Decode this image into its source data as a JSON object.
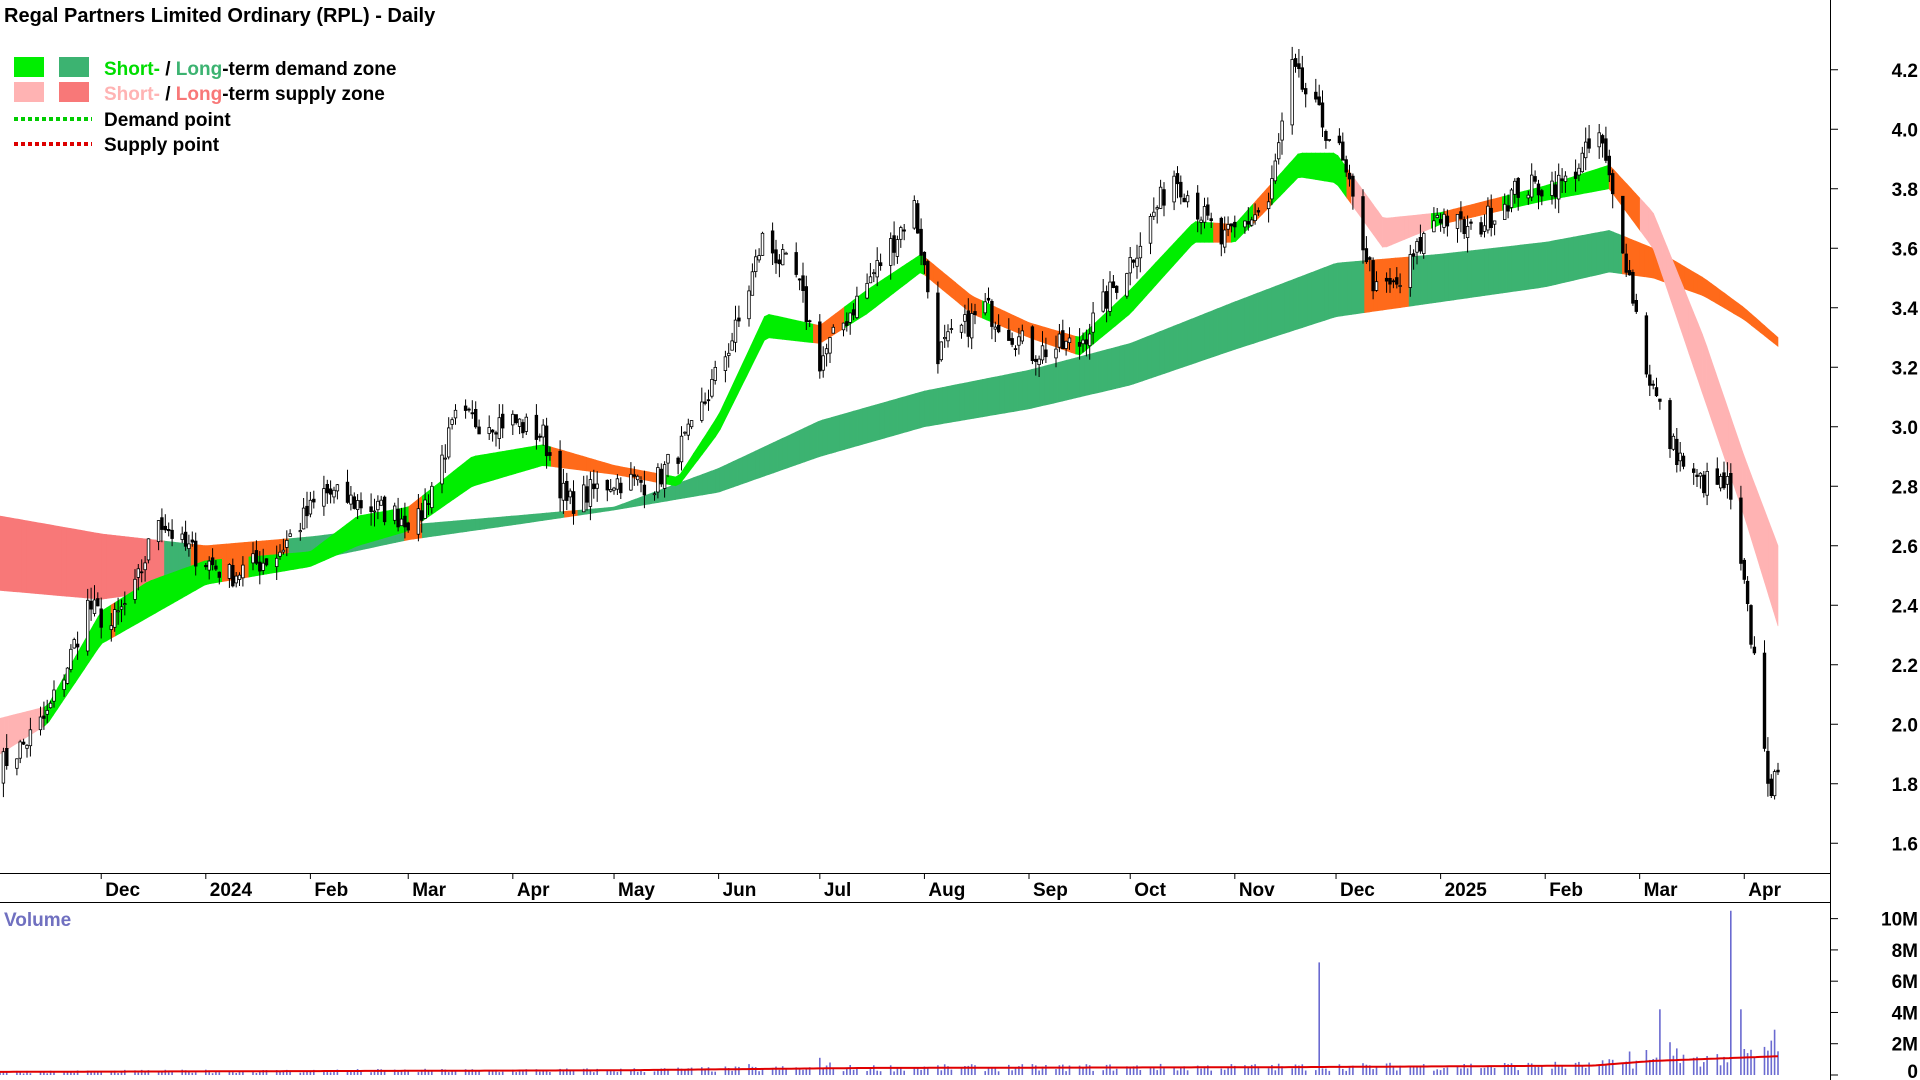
{
  "chart_data": {
    "type": "candlestick",
    "title": "Regal Partners Limited Ordinary (RPL) - Daily",
    "legend": {
      "placement": "top-left",
      "demand_zone": {
        "short": "Short-",
        "sep": " / ",
        "long": "Long",
        "rest": "-term demand zone"
      },
      "supply_zone": {
        "short": "Short-",
        "sep": " / ",
        "long": "Long",
        "rest": "-term supply zone"
      },
      "demand_point": "Demand point",
      "supply_point": "Supply point"
    },
    "colors": {
      "short_demand": "#00ee00",
      "long_demand": "#3cb371",
      "short_supply": "#ffb3b3",
      "long_supply": "#f87878",
      "transition": "#ff6a1a",
      "demand_point": "#00cc00",
      "supply_point": "#dd0000",
      "volume_bar": "#6a6ad0",
      "volume_avg": "#e00000",
      "volume_label": "#7070c0"
    },
    "x_range": [
      "2023-11-01",
      "2025-04-11"
    ],
    "x_ticks": [
      {
        "label": "Dec",
        "date": "2023-12-01"
      },
      {
        "label": "2024",
        "date": "2024-01-01"
      },
      {
        "label": "Feb",
        "date": "2024-02-01"
      },
      {
        "label": "Mar",
        "date": "2024-03-01"
      },
      {
        "label": "Apr",
        "date": "2024-04-01"
      },
      {
        "label": "May",
        "date": "2024-05-01"
      },
      {
        "label": "Jun",
        "date": "2024-06-01"
      },
      {
        "label": "Jul",
        "date": "2024-07-01"
      },
      {
        "label": "Aug",
        "date": "2024-08-01"
      },
      {
        "label": "Sep",
        "date": "2024-09-01"
      },
      {
        "label": "Oct",
        "date": "2024-10-01"
      },
      {
        "label": "Nov",
        "date": "2024-11-01"
      },
      {
        "label": "Dec",
        "date": "2024-12-01"
      },
      {
        "label": "2025",
        "date": "2025-01-01"
      },
      {
        "label": "Feb",
        "date": "2025-02-01"
      },
      {
        "label": "Mar",
        "date": "2025-03-01"
      },
      {
        "label": "Apr",
        "date": "2025-04-01"
      }
    ],
    "price_axis": {
      "ylim": [
        1.5,
        4.3
      ],
      "ticks": [
        "1.6",
        "1.8",
        "2.0",
        "2.2",
        "2.4",
        "2.6",
        "2.8",
        "3.0",
        "3.2",
        "3.4",
        "3.6",
        "3.8",
        "4.0",
        "4.2"
      ]
    },
    "price_path": [
      [
        "2023-11-01",
        1.86
      ],
      [
        "2023-11-08",
        1.93
      ],
      [
        "2023-11-15",
        2.03
      ],
      [
        "2023-11-21",
        2.2
      ],
      [
        "2023-11-27",
        2.4
      ],
      [
        "2023-12-04",
        2.33
      ],
      [
        "2023-12-11",
        2.45
      ],
      [
        "2023-12-18",
        2.7
      ],
      [
        "2023-12-25",
        2.6
      ],
      [
        "2024-01-08",
        2.5
      ],
      [
        "2024-01-22",
        2.57
      ],
      [
        "2024-02-05",
        2.78
      ],
      [
        "2024-02-19",
        2.73
      ],
      [
        "2024-03-04",
        2.68
      ],
      [
        "2024-03-15",
        3.02
      ],
      [
        "2024-04-01",
        3.02
      ],
      [
        "2024-04-10",
        2.97
      ],
      [
        "2024-04-17",
        2.74
      ],
      [
        "2024-05-01",
        2.82
      ],
      [
        "2024-05-13",
        2.81
      ],
      [
        "2024-05-24",
        2.98
      ],
      [
        "2024-06-07",
        3.35
      ],
      [
        "2024-06-14",
        3.63
      ],
      [
        "2024-06-24",
        3.5
      ],
      [
        "2024-07-01",
        3.22
      ],
      [
        "2024-07-15",
        3.48
      ],
      [
        "2024-07-29",
        3.74
      ],
      [
        "2024-08-05",
        3.25
      ],
      [
        "2024-08-19",
        3.4
      ],
      [
        "2024-09-02",
        3.25
      ],
      [
        "2024-09-16",
        3.28
      ],
      [
        "2024-10-01",
        3.56
      ],
      [
        "2024-10-14",
        3.85
      ],
      [
        "2024-10-28",
        3.62
      ],
      [
        "2024-11-11",
        3.75
      ],
      [
        "2024-11-18",
        4.2
      ],
      [
        "2024-12-02",
        3.92
      ],
      [
        "2024-12-13",
        3.45
      ],
      [
        "2024-12-20",
        3.48
      ],
      [
        "2024-12-31",
        3.72
      ],
      [
        "2025-01-10",
        3.65
      ],
      [
        "2025-01-24",
        3.8
      ],
      [
        "2025-02-07",
        3.82
      ],
      [
        "2025-02-17",
        3.98
      ],
      [
        "2025-02-24",
        3.62
      ],
      [
        "2025-03-03",
        3.2
      ],
      [
        "2025-03-10",
        2.95
      ],
      [
        "2025-03-17",
        2.82
      ],
      [
        "2025-03-27",
        2.8
      ],
      [
        "2025-04-01",
        2.45
      ],
      [
        "2025-04-04",
        2.22
      ],
      [
        "2025-04-07",
        1.95
      ],
      [
        "2025-04-09",
        1.72
      ],
      [
        "2025-04-11",
        1.88
      ]
    ],
    "short_zone": {
      "lower": [
        [
          "2023-11-01",
          1.9
        ],
        [
          "2023-11-15",
          2.0
        ],
        [
          "2023-12-01",
          2.27
        ],
        [
          "2023-12-15",
          2.36
        ],
        [
          "2024-01-01",
          2.47
        ],
        [
          "2024-02-01",
          2.53
        ],
        [
          "2024-02-15",
          2.6
        ],
        [
          "2024-03-01",
          2.65
        ],
        [
          "2024-03-20",
          2.8
        ],
        [
          "2024-04-10",
          2.87
        ],
        [
          "2024-05-01",
          2.84
        ],
        [
          "2024-05-20",
          2.8
        ],
        [
          "2024-06-01",
          2.98
        ],
        [
          "2024-06-15",
          3.3
        ],
        [
          "2024-07-01",
          3.28
        ],
        [
          "2024-07-15",
          3.38
        ],
        [
          "2024-07-31",
          3.52
        ],
        [
          "2024-08-15",
          3.38
        ],
        [
          "2024-09-01",
          3.3
        ],
        [
          "2024-09-16",
          3.24
        ],
        [
          "2024-10-01",
          3.38
        ],
        [
          "2024-10-20",
          3.62
        ],
        [
          "2024-11-01",
          3.62
        ],
        [
          "2024-11-20",
          3.84
        ],
        [
          "2024-12-01",
          3.82
        ],
        [
          "2024-12-15",
          3.6
        ],
        [
          "2025-01-01",
          3.68
        ],
        [
          "2025-02-01",
          3.76
        ],
        [
          "2025-02-20",
          3.8
        ],
        [
          "2025-03-05",
          3.6
        ],
        [
          "2025-03-20",
          3.1
        ],
        [
          "2025-04-01",
          2.7
        ],
        [
          "2025-04-11",
          2.33
        ]
      ],
      "upper": [
        [
          "2023-11-01",
          2.02
        ],
        [
          "2023-11-15",
          2.06
        ],
        [
          "2023-12-01",
          2.38
        ],
        [
          "2023-12-15",
          2.48
        ],
        [
          "2024-01-01",
          2.55
        ],
        [
          "2024-02-01",
          2.58
        ],
        [
          "2024-02-15",
          2.7
        ],
        [
          "2024-03-01",
          2.73
        ],
        [
          "2024-03-20",
          2.9
        ],
        [
          "2024-04-10",
          2.94
        ],
        [
          "2024-05-01",
          2.87
        ],
        [
          "2024-05-20",
          2.83
        ],
        [
          "2024-06-01",
          3.04
        ],
        [
          "2024-06-15",
          3.38
        ],
        [
          "2024-07-01",
          3.34
        ],
        [
          "2024-07-15",
          3.46
        ],
        [
          "2024-07-31",
          3.58
        ],
        [
          "2024-08-15",
          3.44
        ],
        [
          "2024-09-01",
          3.35
        ],
        [
          "2024-09-16",
          3.3
        ],
        [
          "2024-10-01",
          3.46
        ],
        [
          "2024-10-20",
          3.69
        ],
        [
          "2024-11-01",
          3.68
        ],
        [
          "2024-11-20",
          3.92
        ],
        [
          "2024-12-01",
          3.92
        ],
        [
          "2024-12-15",
          3.7
        ],
        [
          "2025-01-01",
          3.72
        ],
        [
          "2025-02-01",
          3.81
        ],
        [
          "2025-02-20",
          3.88
        ],
        [
          "2025-03-05",
          3.72
        ],
        [
          "2025-03-20",
          3.3
        ],
        [
          "2025-04-01",
          2.9
        ],
        [
          "2025-04-11",
          2.6
        ]
      ]
    },
    "long_zone": {
      "lower": [
        [
          "2023-11-01",
          2.45
        ],
        [
          "2023-12-01",
          2.42
        ],
        [
          "2024-01-01",
          2.47
        ],
        [
          "2024-02-01",
          2.55
        ],
        [
          "2024-03-01",
          2.62
        ],
        [
          "2024-04-01",
          2.67
        ],
        [
          "2024-05-01",
          2.72
        ],
        [
          "2024-06-01",
          2.78
        ],
        [
          "2024-07-01",
          2.9
        ],
        [
          "2024-08-01",
          3.0
        ],
        [
          "2024-09-01",
          3.06
        ],
        [
          "2024-10-01",
          3.14
        ],
        [
          "2024-11-01",
          3.26
        ],
        [
          "2024-12-01",
          3.37
        ],
        [
          "2025-01-01",
          3.42
        ],
        [
          "2025-02-01",
          3.47
        ],
        [
          "2025-02-20",
          3.52
        ],
        [
          "2025-03-05",
          3.5
        ],
        [
          "2025-03-20",
          3.44
        ],
        [
          "2025-04-01",
          3.36
        ],
        [
          "2025-04-11",
          3.27
        ]
      ],
      "upper": [
        [
          "2023-11-01",
          2.7
        ],
        [
          "2023-12-01",
          2.64
        ],
        [
          "2024-01-01",
          2.6
        ],
        [
          "2024-02-01",
          2.63
        ],
        [
          "2024-03-01",
          2.67
        ],
        [
          "2024-04-01",
          2.7
        ],
        [
          "2024-05-01",
          2.73
        ],
        [
          "2024-06-01",
          2.86
        ],
        [
          "2024-07-01",
          3.02
        ],
        [
          "2024-08-01",
          3.12
        ],
        [
          "2024-09-01",
          3.19
        ],
        [
          "2024-10-01",
          3.28
        ],
        [
          "2024-11-01",
          3.42
        ],
        [
          "2024-12-01",
          3.55
        ],
        [
          "2025-01-01",
          3.58
        ],
        [
          "2025-02-01",
          3.62
        ],
        [
          "2025-02-20",
          3.66
        ],
        [
          "2025-03-05",
          3.6
        ],
        [
          "2025-03-20",
          3.5
        ],
        [
          "2025-04-01",
          3.4
        ],
        [
          "2025-04-11",
          3.3
        ]
      ]
    },
    "volume": {
      "label": "Volume",
      "ylim": [
        0,
        11000000
      ],
      "ticks": [
        "0",
        "2M",
        "4M",
        "6M",
        "8M",
        "10M"
      ],
      "tick_values": [
        0,
        2000000,
        4000000,
        6000000,
        8000000,
        10000000
      ],
      "baseline": 250000,
      "average": [
        [
          "2023-11-01",
          200000
        ],
        [
          "2024-05-01",
          300000
        ],
        [
          "2024-07-15",
          450000
        ],
        [
          "2024-11-15",
          500000
        ],
        [
          "2025-02-15",
          600000
        ],
        [
          "2025-03-05",
          900000
        ],
        [
          "2025-04-11",
          1200000
        ]
      ],
      "spikes": [
        [
          "2024-06-10",
          700000
        ],
        [
          "2024-07-01",
          1100000
        ],
        [
          "2024-07-04",
          800000
        ],
        [
          "2024-11-26",
          7200000
        ],
        [
          "2025-02-26",
          1500000
        ],
        [
          "2025-03-03",
          1600000
        ],
        [
          "2025-03-07",
          4200000
        ],
        [
          "2025-03-10",
          2100000
        ],
        [
          "2025-03-12",
          1700000
        ],
        [
          "2025-03-14",
          1300000
        ],
        [
          "2025-03-28",
          10500000
        ],
        [
          "2025-03-31",
          4200000
        ],
        [
          "2025-04-02",
          1400000
        ],
        [
          "2025-04-07",
          1800000
        ],
        [
          "2025-04-09",
          2200000
        ],
        [
          "2025-04-10",
          2900000
        ]
      ]
    }
  }
}
